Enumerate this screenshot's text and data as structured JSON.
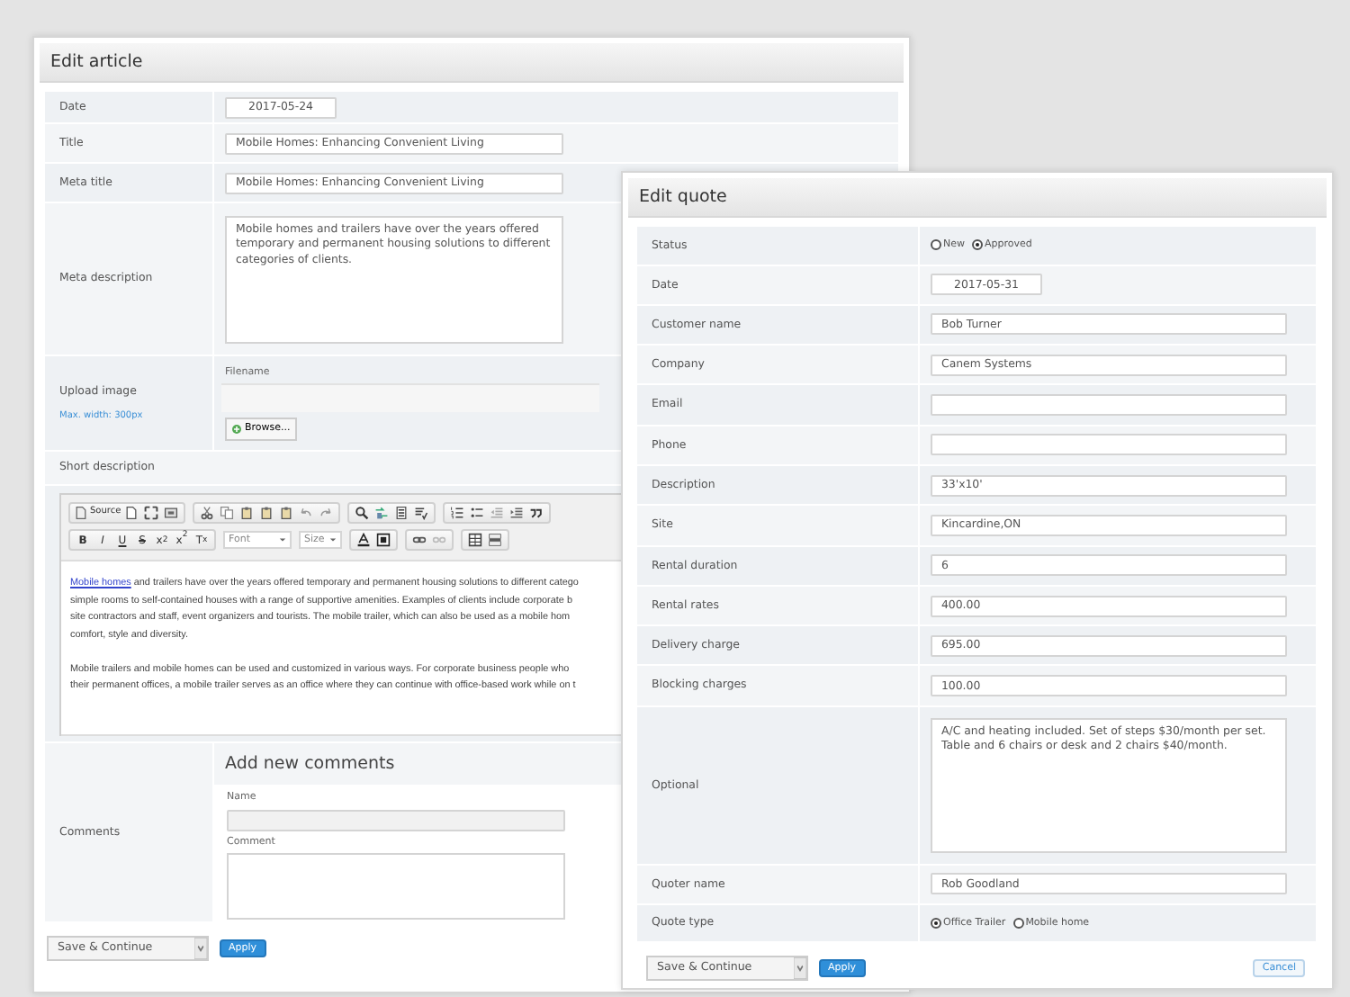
{
  "article": {
    "title": "Edit article",
    "fields": [
      {
        "kind": "date",
        "label": "Date",
        "value": "2017-05-24"
      },
      {
        "kind": "text",
        "label": "Title",
        "value": "Mobile Homes: Enhancing Convenient Living"
      },
      {
        "kind": "text",
        "label": "Meta title",
        "value": "Mobile Homes: Enhancing Convenient Living"
      },
      {
        "kind": "textarea",
        "label": "Meta description",
        "value": "Mobile homes and trailers have over the years offered temporary and permanent housing solutions to different categories of clients."
      },
      {
        "kind": "upload",
        "label": "Upload image",
        "hint": "Max. width: 300px",
        "filename_label": "Filename",
        "button": "Browse..."
      },
      {
        "kind": "heading",
        "label": "Short description"
      }
    ],
    "editor": {
      "row1_texts": [
        "Source"
      ],
      "row2_texts": [
        "B",
        "I",
        "U",
        "S",
        "x$_{2}$",
        "x$^{2}$",
        "T$_{x}$",
        "Font",
        "Size"
      ],
      "paragraphs": [
        {
          "lines": [
            {
              "link": "Mobile homes",
              "text": " and trailers have over the years offered temporary and permanent housing solutions to different catego"
            },
            {
              "text": "simple rooms to self-contained houses with a range of supportive amenities. Examples of clients include corporate b"
            },
            {
              "text": "site contractors and staff, event organizers and tourists. The mobile trailer, which can also be used as a mobile hom"
            },
            {
              "text": "comfort, style and diversity."
            }
          ]
        },
        {
          "lines": [
            {
              "text": "Mobile trailers and mobile homes can be used and customized in various ways. For corporate business people who"
            },
            {
              "text": "their permanent offices, a mobile trailer serves as an office where they can continue with office-based work while on t"
            }
          ]
        }
      ]
    },
    "comments": {
      "label": "Comments",
      "heading": "Add new comments",
      "name_label": "Name",
      "comment_label": "Comment"
    },
    "footer": {
      "action": "Save & Continue",
      "apply": "Apply"
    }
  },
  "quote": {
    "title": "Edit quote",
    "fields": [
      {
        "kind": "radio",
        "label": "Status",
        "options": [
          {
            "label": "New",
            "selected": false
          },
          {
            "label": "Approved",
            "selected": true
          }
        ]
      },
      {
        "kind": "date",
        "label": "Date",
        "value": "2017-05-31"
      },
      {
        "kind": "text",
        "label": "Customer name",
        "value": "Bob Turner"
      },
      {
        "kind": "text",
        "label": "Company",
        "value": "Canem Systems"
      },
      {
        "kind": "text",
        "label": "Email"
      },
      {
        "kind": "text",
        "label": "Phone"
      },
      {
        "kind": "text",
        "label": "Description",
        "value": "33'x10'"
      },
      {
        "kind": "text",
        "label": "Site",
        "value": "Kincardine,ON"
      },
      {
        "kind": "text",
        "label": "Rental duration",
        "value": "6"
      },
      {
        "kind": "text",
        "label": "Rental rates",
        "value": "400.00"
      },
      {
        "kind": "text",
        "label": "Delivery charge",
        "value": "695.00"
      },
      {
        "kind": "text",
        "label": "Blocking charges",
        "value": "100.00"
      },
      {
        "kind": "textarea",
        "label": "Optional",
        "value": "A/C and heating included. Set of steps $30/month per set. Table and 6 chairs or desk and 2 chairs $40/month."
      },
      {
        "kind": "text",
        "label": "Quoter name",
        "value": "Rob Goodland"
      },
      {
        "kind": "radio",
        "label": "Quote type",
        "options": [
          {
            "label": "Office Trailer",
            "selected": true
          },
          {
            "label": "Mobile home",
            "selected": false
          }
        ]
      }
    ],
    "footer": {
      "action": "Save & Continue",
      "apply": "Apply",
      "cancel": "Cancel"
    }
  }
}
